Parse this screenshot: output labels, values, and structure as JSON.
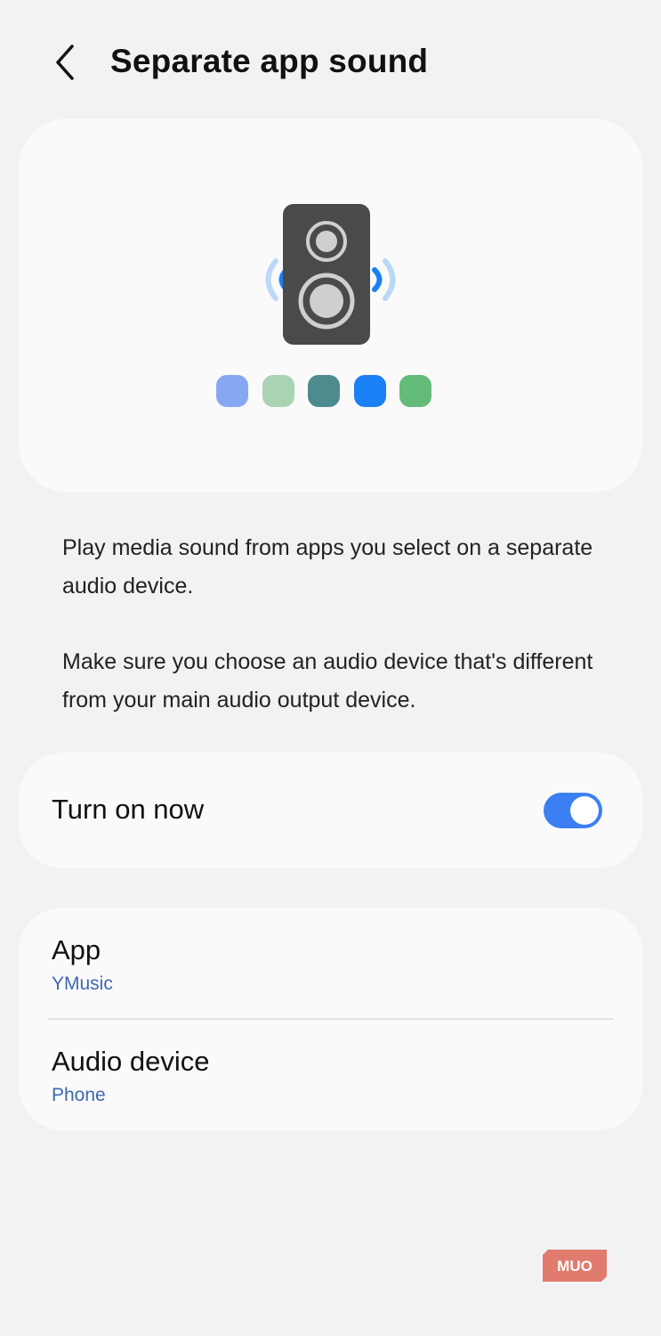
{
  "header": {
    "back_icon": "chevron-left-icon",
    "title": "Separate app sound"
  },
  "hero": {
    "icon": "speaker-icon",
    "dot_colors": [
      "#86a8f3",
      "#a9d4b4",
      "#4e8b8e",
      "#1a80f5",
      "#63bb7a"
    ]
  },
  "description": {
    "paragraph1": "Play media sound from apps you select on a separate audio device.",
    "paragraph2": "Make sure you choose an audio device that's different from your main audio output device."
  },
  "toggle": {
    "label": "Turn on now",
    "on": true
  },
  "settings": {
    "app_title": "App",
    "app_value": "YMusic",
    "device_title": "Audio device",
    "device_value": "Phone"
  },
  "watermark": {
    "text": "MUO"
  },
  "colors": {
    "accent": "#3b7ff2",
    "link": "#3e68b0",
    "background": "#f2f2f2",
    "card": "#fafafa"
  }
}
